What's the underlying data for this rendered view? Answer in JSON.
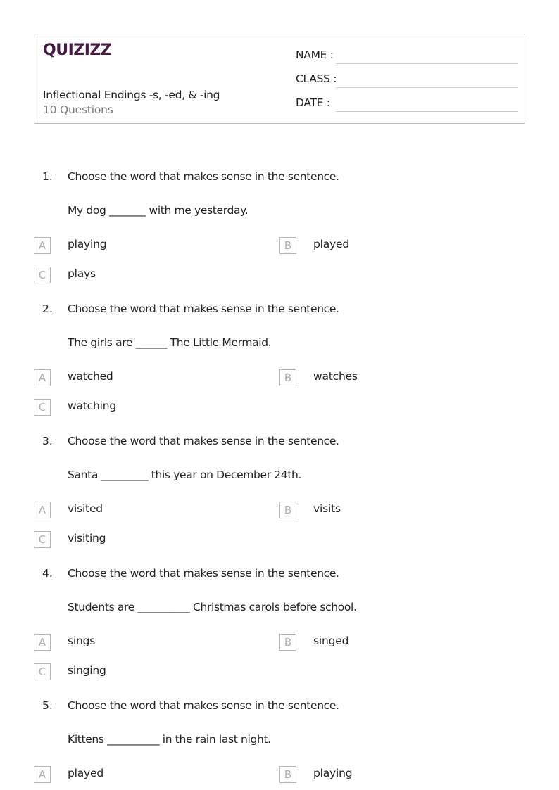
{
  "brand": {
    "logo_text": "QUIZIZZ",
    "color": "#461a42"
  },
  "worksheet": {
    "title": "Inflectional Endings -s, -ed, & -ing",
    "question_count": "10 Questions"
  },
  "fields": [
    {
      "label": "NAME :"
    },
    {
      "label": "CLASS :"
    },
    {
      "label": "DATE  :"
    }
  ],
  "questions": [
    {
      "number": "1.",
      "prompt": "Choose the word that makes sense in the sentence.",
      "sentence": "My dog _______ with me yesterday.",
      "options": [
        {
          "letter": "A",
          "text": "playing"
        },
        {
          "letter": "B",
          "text": "played"
        },
        {
          "letter": "C",
          "text": "plays"
        }
      ]
    },
    {
      "number": "2.",
      "prompt": "Choose the word that makes sense in the sentence.",
      "sentence": "The girls are ______ The Little Mermaid.",
      "options": [
        {
          "letter": "A",
          "text": "watched"
        },
        {
          "letter": "B",
          "text": "watches"
        },
        {
          "letter": "C",
          "text": "watching"
        }
      ]
    },
    {
      "number": "3.",
      "prompt": "Choose the word that makes sense in the sentence.",
      "sentence": "Santa _________ this year on December 24th.",
      "options": [
        {
          "letter": "A",
          "text": "visited"
        },
        {
          "letter": "B",
          "text": "visits"
        },
        {
          "letter": "C",
          "text": "visiting"
        }
      ]
    },
    {
      "number": "4.",
      "prompt": "Choose the word that makes sense in the sentence.",
      "sentence": "Students are __________ Christmas carols before school.",
      "options": [
        {
          "letter": "A",
          "text": "sings"
        },
        {
          "letter": "B",
          "text": "singed"
        },
        {
          "letter": "C",
          "text": "singing"
        }
      ]
    },
    {
      "number": "5.",
      "prompt": "Choose the word that makes sense in the sentence.",
      "sentence": "Kittens __________ in the rain last night.",
      "options": [
        {
          "letter": "A",
          "text": "played"
        },
        {
          "letter": "B",
          "text": "playing"
        }
      ]
    }
  ]
}
